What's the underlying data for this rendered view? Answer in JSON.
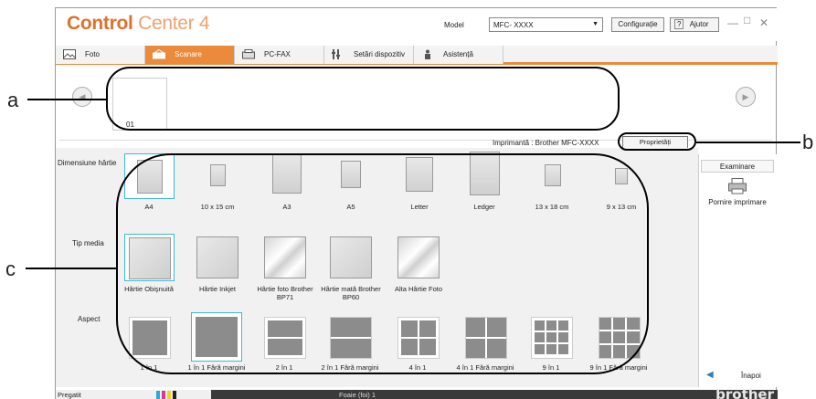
{
  "app": {
    "logo_word1": "Control",
    "logo_word2": "Center 4",
    "model_label": "Model",
    "model_value": "MFC- XXXX",
    "config_button": "Configurație",
    "help_question": "?",
    "help_button": "Ajutor",
    "minimize": "—",
    "maximize": "□",
    "close": "✕"
  },
  "tabs": [
    {
      "label": "Foto",
      "icon": "photo-icon",
      "active": false
    },
    {
      "label": "Scanare",
      "icon": "scanner-icon",
      "active": true
    },
    {
      "label": "PC-FAX",
      "icon": "fax-icon",
      "active": false
    },
    {
      "label": "Setări dispozitiv",
      "icon": "device-settings-icon",
      "active": false
    },
    {
      "label": "Asistență",
      "icon": "person-icon",
      "active": false
    }
  ],
  "thumbnails": {
    "prev": "◀",
    "next": "▶",
    "page_number": "01"
  },
  "printer": {
    "label": "Imprimantă : Brother MFC-XXXX",
    "properties_button": "Proprietăți"
  },
  "settings": {
    "paper_size_label": "Dimensiune hârtie",
    "paper_sizes": [
      "A4",
      "10 x 15 cm",
      "A3",
      "A5",
      "Letter",
      "Ledger",
      "13 x 18 cm",
      "9 x 13 cm"
    ],
    "media_type_label": "Tip media",
    "media_types": [
      "Hârtie Obişnuită",
      "Hârtie Inkjet",
      "Hârtie foto Brother BP71",
      "Hârtie mată Brother BP60",
      "Alta Hârtie Foto"
    ],
    "aspect_label": "Aspect",
    "aspects": [
      "1 în 1",
      "1 în 1 Fără margini",
      "2 în 1",
      "2 în 1 Fără margini",
      "4 în 1",
      "4 în 1 Fără margini",
      "9 în 1",
      "9 în 1 Fără margini"
    ]
  },
  "side_panel": {
    "browse": "Examinare",
    "start_print": "Pornire imprimare",
    "back": "Înapoi"
  },
  "status": {
    "state": "Pregatit",
    "sheets": "Foaie (foi) 1",
    "brand": "brother"
  },
  "callouts": [
    "a",
    "b",
    "c"
  ],
  "colors": {
    "accent": "#ea8a3a",
    "selection": "#3cb9d5",
    "ink_c": "#2aa7d9",
    "ink_m": "#d23c8c",
    "ink_y": "#f2d21e",
    "ink_k": "#222222"
  }
}
